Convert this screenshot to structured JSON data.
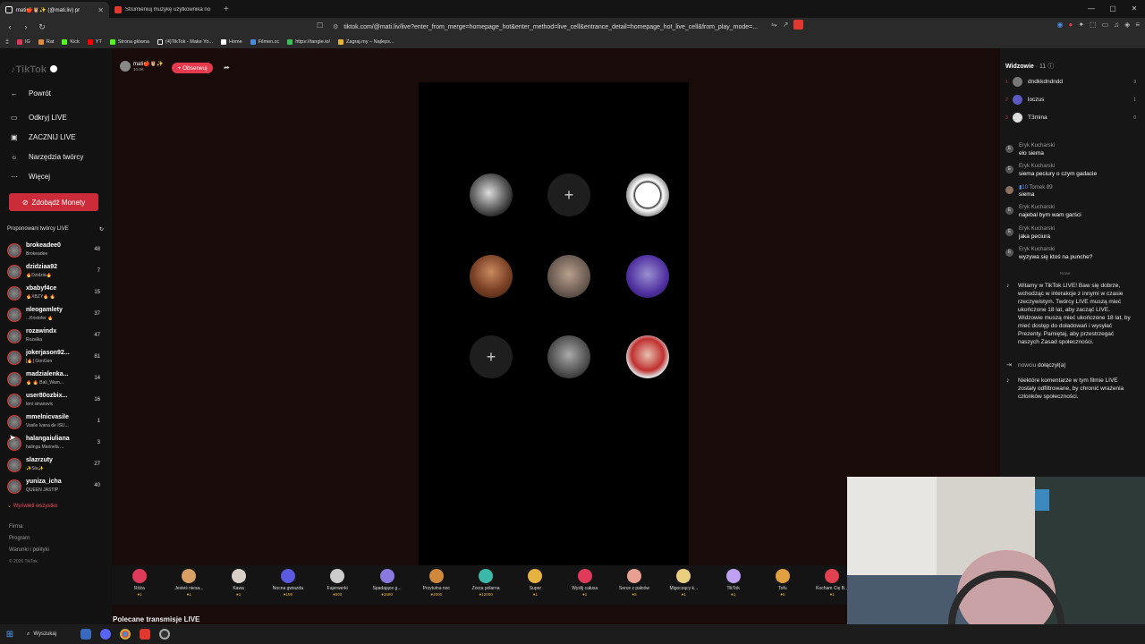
{
  "browser": {
    "tabs": [
      {
        "title": "mati🍎🦉✨ (@mati.liv) pr",
        "color": "#ffffff"
      },
      {
        "title": "Strumieniuj muzykę użytkownika no",
        "color": "#e0372f"
      }
    ],
    "url": "tiktok.com/@mati.liv/live?enter_from_merge=homepage_hot&enter_method=live_cell&entrance_detail=homepage_hot_live_cell&from_play_mode=...",
    "bookmarks": [
      "IG",
      "Rat",
      "Kick",
      "YT",
      "Strona główna",
      "(4)TikTok - Make Yo...",
      "Home",
      "Filmen.cc",
      "https://tangle.io/",
      "Zagraj.my – Najleps..."
    ]
  },
  "sidebar": {
    "back": "Powrót",
    "nav": [
      {
        "label": "Odkryj LIVE",
        "icon": "screen-icon"
      },
      {
        "label": "ZACZNIJ LIVE",
        "icon": "camera-icon"
      },
      {
        "label": "Narzędzia twórcy",
        "icon": "lightbulb-icon"
      },
      {
        "label": "Więcej",
        "icon": "more-icon"
      }
    ],
    "coins_button": "Zdobądź Monety",
    "suggested_title": "Proponowani twórcy LIVE",
    "creators": [
      {
        "name": "brokeadee0",
        "sub": "Brokeadee",
        "count": "48"
      },
      {
        "name": "dzidziaa92",
        "sub": "🔥Dzidzia🔥",
        "count": "7"
      },
      {
        "name": "xbabyf4ce",
        "sub": "🔥XBZY🔥 🔥",
        "count": "15"
      },
      {
        "name": "nleogamlety",
        "sub": "...Kristofer 🔥",
        "count": "37"
      },
      {
        "name": "rozawindx",
        "sub": "Rozalka",
        "count": "47"
      },
      {
        "name": "jokerjason92...",
        "sub": "[🔥] GonGen",
        "count": "81"
      },
      {
        "name": "madzialenka...",
        "sub": "🔥 🔥 Bali_Wam...",
        "count": "14"
      },
      {
        "name": "user80ozbix...",
        "sub": "toni sinanovic",
        "count": "16"
      },
      {
        "name": "mmelnicvasile",
        "sub": "Vasile Ivana de ISU...",
        "count": "1"
      },
      {
        "name": "halangaiuliana",
        "sub": "halinga Marinela ...",
        "count": "3"
      },
      {
        "name": "slazrzuty",
        "sub": "✨Sla✨",
        "count": "27"
      },
      {
        "name": "yuniza_icha",
        "sub": "QUEEN JASTIP",
        "count": "40"
      }
    ],
    "show_all": "Wyświetl wszystko",
    "footer": [
      "Firma",
      "Program",
      "Warunki i polityki",
      "© 2026 TikTok"
    ]
  },
  "stream": {
    "host_name": "mati🍎🦉✨",
    "host_sub": "10.0K",
    "follow_label": "+ Obserwuj"
  },
  "gifts": [
    {
      "name": "Róża",
      "price": "1",
      "color": "#e03a5a"
    },
    {
      "name": "Jesteś niesa...",
      "price": "1",
      "color": "#d9a066"
    },
    {
      "name": "Kawa",
      "price": "1",
      "color": "#d8d0c8"
    },
    {
      "name": "Nocna gwiazda",
      "price": "199",
      "color": "#5a5ae0"
    },
    {
      "name": "Fajerwerki",
      "price": "500",
      "color": "#cccccc"
    },
    {
      "name": "Spadające g...",
      "price": "1580",
      "color": "#8a7ae0"
    },
    {
      "name": "Przytulna noc",
      "price": "4000",
      "color": "#d0883a"
    },
    {
      "name": "Zorza polarna",
      "price": "12000",
      "color": "#3ab8a8"
    },
    {
      "name": "Super",
      "price": "1",
      "color": "#e6b340"
    },
    {
      "name": "Wyślij całusa",
      "price": "1",
      "color": "#e03a5a"
    },
    {
      "name": "Serce z palców",
      "price": "5",
      "color": "#e8a090"
    },
    {
      "name": "Migoczący k...",
      "price": "1",
      "color": "#e8d080"
    },
    {
      "name": "TikTok",
      "price": "1",
      "color": "#c0a0f0"
    },
    {
      "name": "Tofu",
      "price": "5",
      "color": "#e0a040"
    },
    {
      "name": "Kocham Cię B...",
      "price": "1",
      "color": "#e04050"
    }
  ],
  "recommended_title": "Polecane transmisje LIVE",
  "viewers": {
    "title": "Widzowie",
    "count": "· 11",
    "list": [
      {
        "rank": "1",
        "name": "dndkkdndndd",
        "count": "3"
      },
      {
        "rank": "2",
        "name": "loczus",
        "count": "1"
      },
      {
        "rank": "3",
        "name": "T3mina",
        "count": "0"
      }
    ]
  },
  "comments": [
    {
      "user": "Eryk Kucharski",
      "text": "elo siema"
    },
    {
      "user": "Eryk Kucharski",
      "text": "siema peciury o czym gadacie"
    },
    {
      "user": "Tomek 89",
      "text": "siema"
    },
    {
      "user": "Eryk Kucharski",
      "text": "najebal bym wam garści"
    },
    {
      "user": "Eryk Kucharski",
      "text": "jaka peciura"
    },
    {
      "user": "Eryk Kucharski",
      "text": "wyzywa się ktoś na punche?"
    }
  ],
  "new_label": "Nowe",
  "system_msgs": {
    "welcome": "Witamy w TikTok LIVE! Baw się dobrze, wchodząc w interakcje z innymi w czasie rzeczywistym. Twórcy LIVE muszą mieć ukończone 18 lat, aby zacząć LIVE. Widzowie muszą mieć ukończone 18 lat, by mieć dostęp do doładowań i wysyłać Prezenty. Pamiętaj, aby przestrzegać naszych Zasad społeczności.",
    "joined_user": "nowciu",
    "joined_text": "dołączył(a)",
    "filtered": "Niektóre komentarze w tym filmie LIVE zostały odfiltrowane, by chronić wrażenia członków społeczności."
  },
  "taskbar": {
    "search": "Wyszukaj"
  },
  "colors": {
    "accent": "#e53a4d",
    "coins": "#cc2b3a",
    "gift_price": "#e6b340"
  }
}
